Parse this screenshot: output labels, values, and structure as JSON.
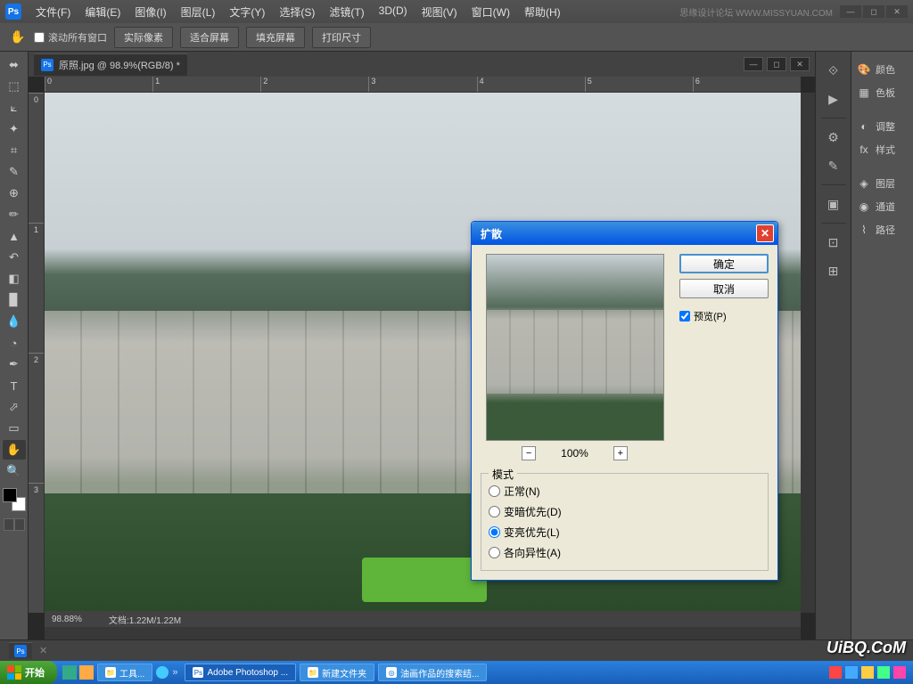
{
  "app": {
    "logo": "Ps",
    "watermark": "思缘设计论坛 WWW.MISSYUAN.COM"
  },
  "menu": [
    "文件(F)",
    "编辑(E)",
    "图像(I)",
    "图层(L)",
    "文字(Y)",
    "选择(S)",
    "滤镜(T)",
    "3D(D)",
    "视图(V)",
    "窗口(W)",
    "帮助(H)"
  ],
  "options": {
    "scroll_all": "滚动所有窗口",
    "buttons": [
      "实际像素",
      "适合屏幕",
      "填充屏幕",
      "打印尺寸"
    ]
  },
  "document": {
    "tab_title": "原照.jpg @ 98.9%(RGB/8) *",
    "zoom": "98.88%",
    "docsize": "文档:1.22M/1.22M"
  },
  "ruler_h": [
    "0",
    "1",
    "2",
    "3",
    "4",
    "5",
    "6"
  ],
  "ruler_v": [
    "0",
    "1",
    "2",
    "3"
  ],
  "panels": [
    {
      "icon": "🎨",
      "label": "颜色"
    },
    {
      "icon": "▦",
      "label": "色板"
    },
    {
      "sep": true
    },
    {
      "icon": "◐",
      "label": "调整"
    },
    {
      "icon": "fx",
      "label": "样式"
    },
    {
      "sep": true
    },
    {
      "icon": "◈",
      "label": "图层"
    },
    {
      "icon": "◉",
      "label": "通道"
    },
    {
      "icon": "⌇",
      "label": "路径"
    }
  ],
  "dock_icons": [
    "⟐",
    "▶",
    "",
    "⚙",
    "✎",
    "",
    "▣",
    "",
    "⊡",
    "⊞"
  ],
  "dialog": {
    "title": "扩散",
    "ok": "确定",
    "cancel": "取消",
    "preview": "预览(P)",
    "zoom": "100%",
    "mode_label": "模式",
    "modes": [
      {
        "label": "正常(N)",
        "checked": false
      },
      {
        "label": "变暗优先(D)",
        "checked": false
      },
      {
        "label": "变亮优先(L)",
        "checked": true
      },
      {
        "label": "各向异性(A)",
        "checked": false
      }
    ]
  },
  "taskbar": {
    "start": "开始",
    "quick1": "工具...",
    "items": [
      {
        "icon": "Ps",
        "label": "Adobe Photoshop ...",
        "active": true
      },
      {
        "icon": "📁",
        "label": "新建文件夹",
        "active": false
      },
      {
        "icon": "◎",
        "label": "油画作品的搜索结...",
        "active": false
      }
    ]
  },
  "watermark_img": "UiBQ.CoM"
}
